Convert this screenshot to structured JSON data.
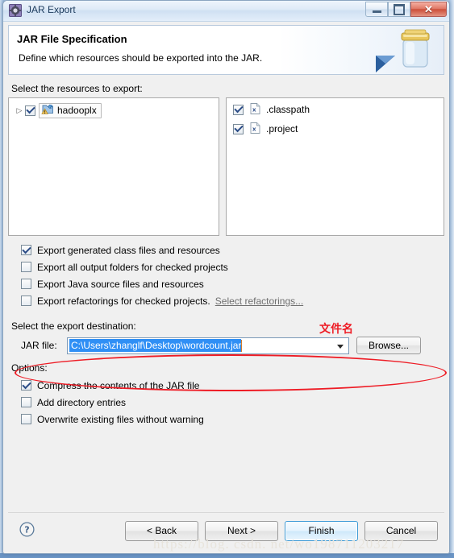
{
  "window": {
    "title": "JAR Export",
    "app_icon": "jar-export-icon",
    "buttons": {
      "minimize": "minimize-icon",
      "restore": "restore-icon",
      "close": "close-icon"
    }
  },
  "header": {
    "title": "JAR File Specification",
    "subtitle": "Define which resources should be exported into the JAR.",
    "art_icon": "jar-jar-illustration"
  },
  "resources": {
    "label": "Select the resources to export:",
    "tree": [
      {
        "label": "hadooplx",
        "checked": true,
        "expandable": true,
        "icon": "java-project-warning-icon"
      }
    ],
    "files": [
      {
        "label": ".classpath",
        "checked": true,
        "icon": "xml-file-icon"
      },
      {
        "label": ".project",
        "checked": true,
        "icon": "xml-file-icon"
      }
    ]
  },
  "export_options": [
    {
      "label": "Export generated class files and resources",
      "checked": true
    },
    {
      "label": "Export all output folders for checked projects",
      "checked": false
    },
    {
      "label": "Export Java source files and resources",
      "checked": false
    },
    {
      "label": "Export refactorings for checked projects.",
      "checked": false,
      "link": "Select refactorings..."
    }
  ],
  "destination": {
    "label": "Select the export destination:",
    "field_label": "JAR file:",
    "value": "C:\\Users\\zhanglf\\Desktop\\wordcount.jar",
    "selected": true,
    "browse_label": "Browse..."
  },
  "options": {
    "label": "Options:",
    "items": [
      {
        "label": "Compress the contents of the JAR file",
        "checked": true
      },
      {
        "label": "Add directory entries",
        "checked": false
      },
      {
        "label": "Overwrite existing files without warning",
        "checked": false
      }
    ]
  },
  "footer": {
    "help_icon": "help-question-icon",
    "back_label": "< Back",
    "next_label": "Next >",
    "finish_label": "Finish",
    "cancel_label": "Cancel"
  },
  "annotations": {
    "ellipse_note": "文件名",
    "watermark": "https://blog. csdn. net/wo198711203217"
  },
  "colors": {
    "annotation_red": "#ee1c25",
    "selection_blue": "#2f8ff5",
    "focus_blue": "#3c9ad6"
  }
}
